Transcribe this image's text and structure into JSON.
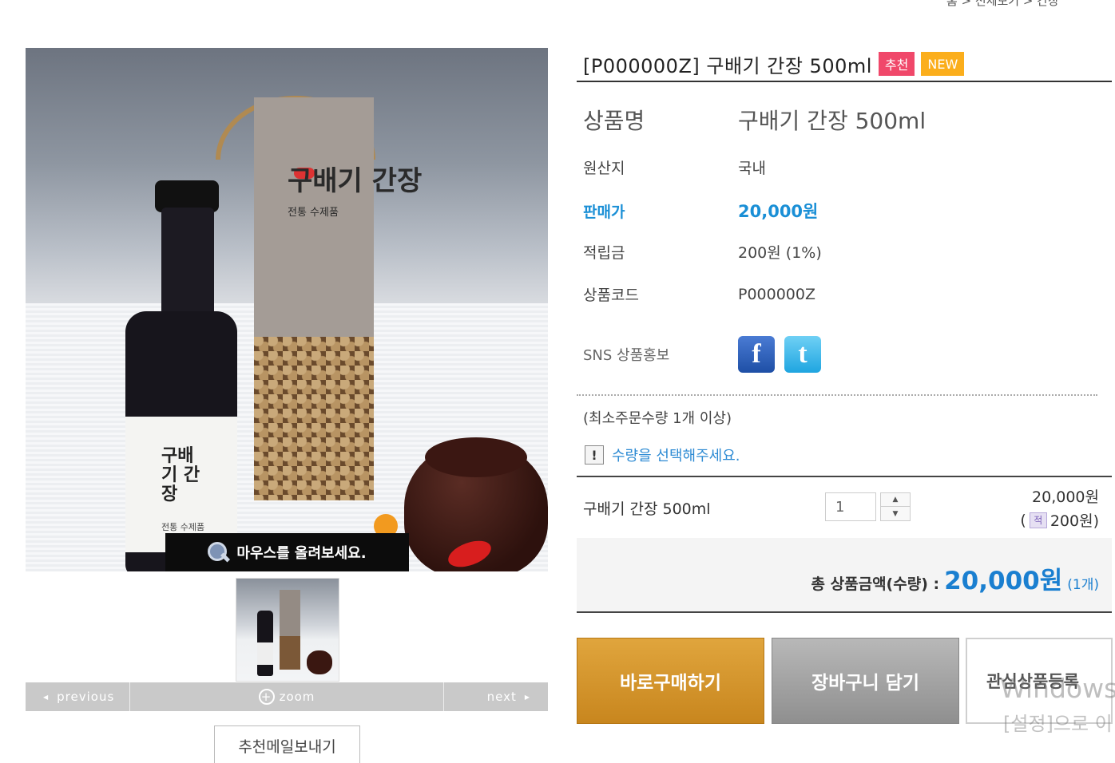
{
  "breadcrumb": "홈 > 전체보기 > 간장",
  "product": {
    "title": "[P000000Z] 구배기 간장 500ml",
    "badges": {
      "recommend": "추천",
      "new": "NEW"
    },
    "rows": {
      "name": {
        "label": "상품명",
        "value": "구배기 간장 500ml"
      },
      "origin": {
        "label": "원산지",
        "value": "국내"
      },
      "price": {
        "label": "판매가",
        "value": "20,000원"
      },
      "points": {
        "label": "적립금",
        "value": "200원 (1%)"
      },
      "code": {
        "label": "상품코드",
        "value": "P000000Z"
      },
      "sns": {
        "label": "SNS 상품홍보",
        "facebook_glyph": "f",
        "twitter_glyph": "t"
      }
    },
    "min_order": "(최소주문수량 1개 이상)",
    "select_message": "수량을 선택해주세요.",
    "warning_glyph": "!"
  },
  "image": {
    "zoom_hint": "마우스를 올려보세요.",
    "bottle_label": "구배기 간장",
    "bottle_sub": "전통 수제품",
    "box_label": "구배기 간장",
    "box_sub": "전통 수제품",
    "nav": {
      "previous": "previous",
      "zoom": "zoom",
      "next": "next",
      "zoom_glyph": "+"
    },
    "recommend_mail": "추천메일보내기"
  },
  "option": {
    "name": "구배기 간장 500ml",
    "quantity": "1",
    "price": "20,000원",
    "point_badge": "적",
    "point_open": "(",
    "point_value": "200원)",
    "stepper_up": "▲",
    "stepper_down": "▼"
  },
  "total": {
    "label": "총 상품금액(수량) :",
    "amount": "20,000원",
    "count": "(1개)"
  },
  "buttons": {
    "buy_now": "바로구매하기",
    "add_cart": "장바구니 담기",
    "wishlist": "관심상품등록"
  },
  "overlay": {
    "watermark": "Windows",
    "watermark_sub": "[설정]으로 이"
  },
  "colors": {
    "price_blue": "#1a8fd6",
    "badge_recommend": "#f0486a",
    "badge_new": "#fbae1c",
    "buy_button": "#c8861e",
    "cart_button": "#8f8f8f"
  },
  "icons": [
    "magnifier-icon",
    "plus-circle-icon",
    "facebook-icon",
    "twitter-icon",
    "warning-icon",
    "point-icon",
    "stepper-up-icon",
    "stepper-down-icon"
  ]
}
